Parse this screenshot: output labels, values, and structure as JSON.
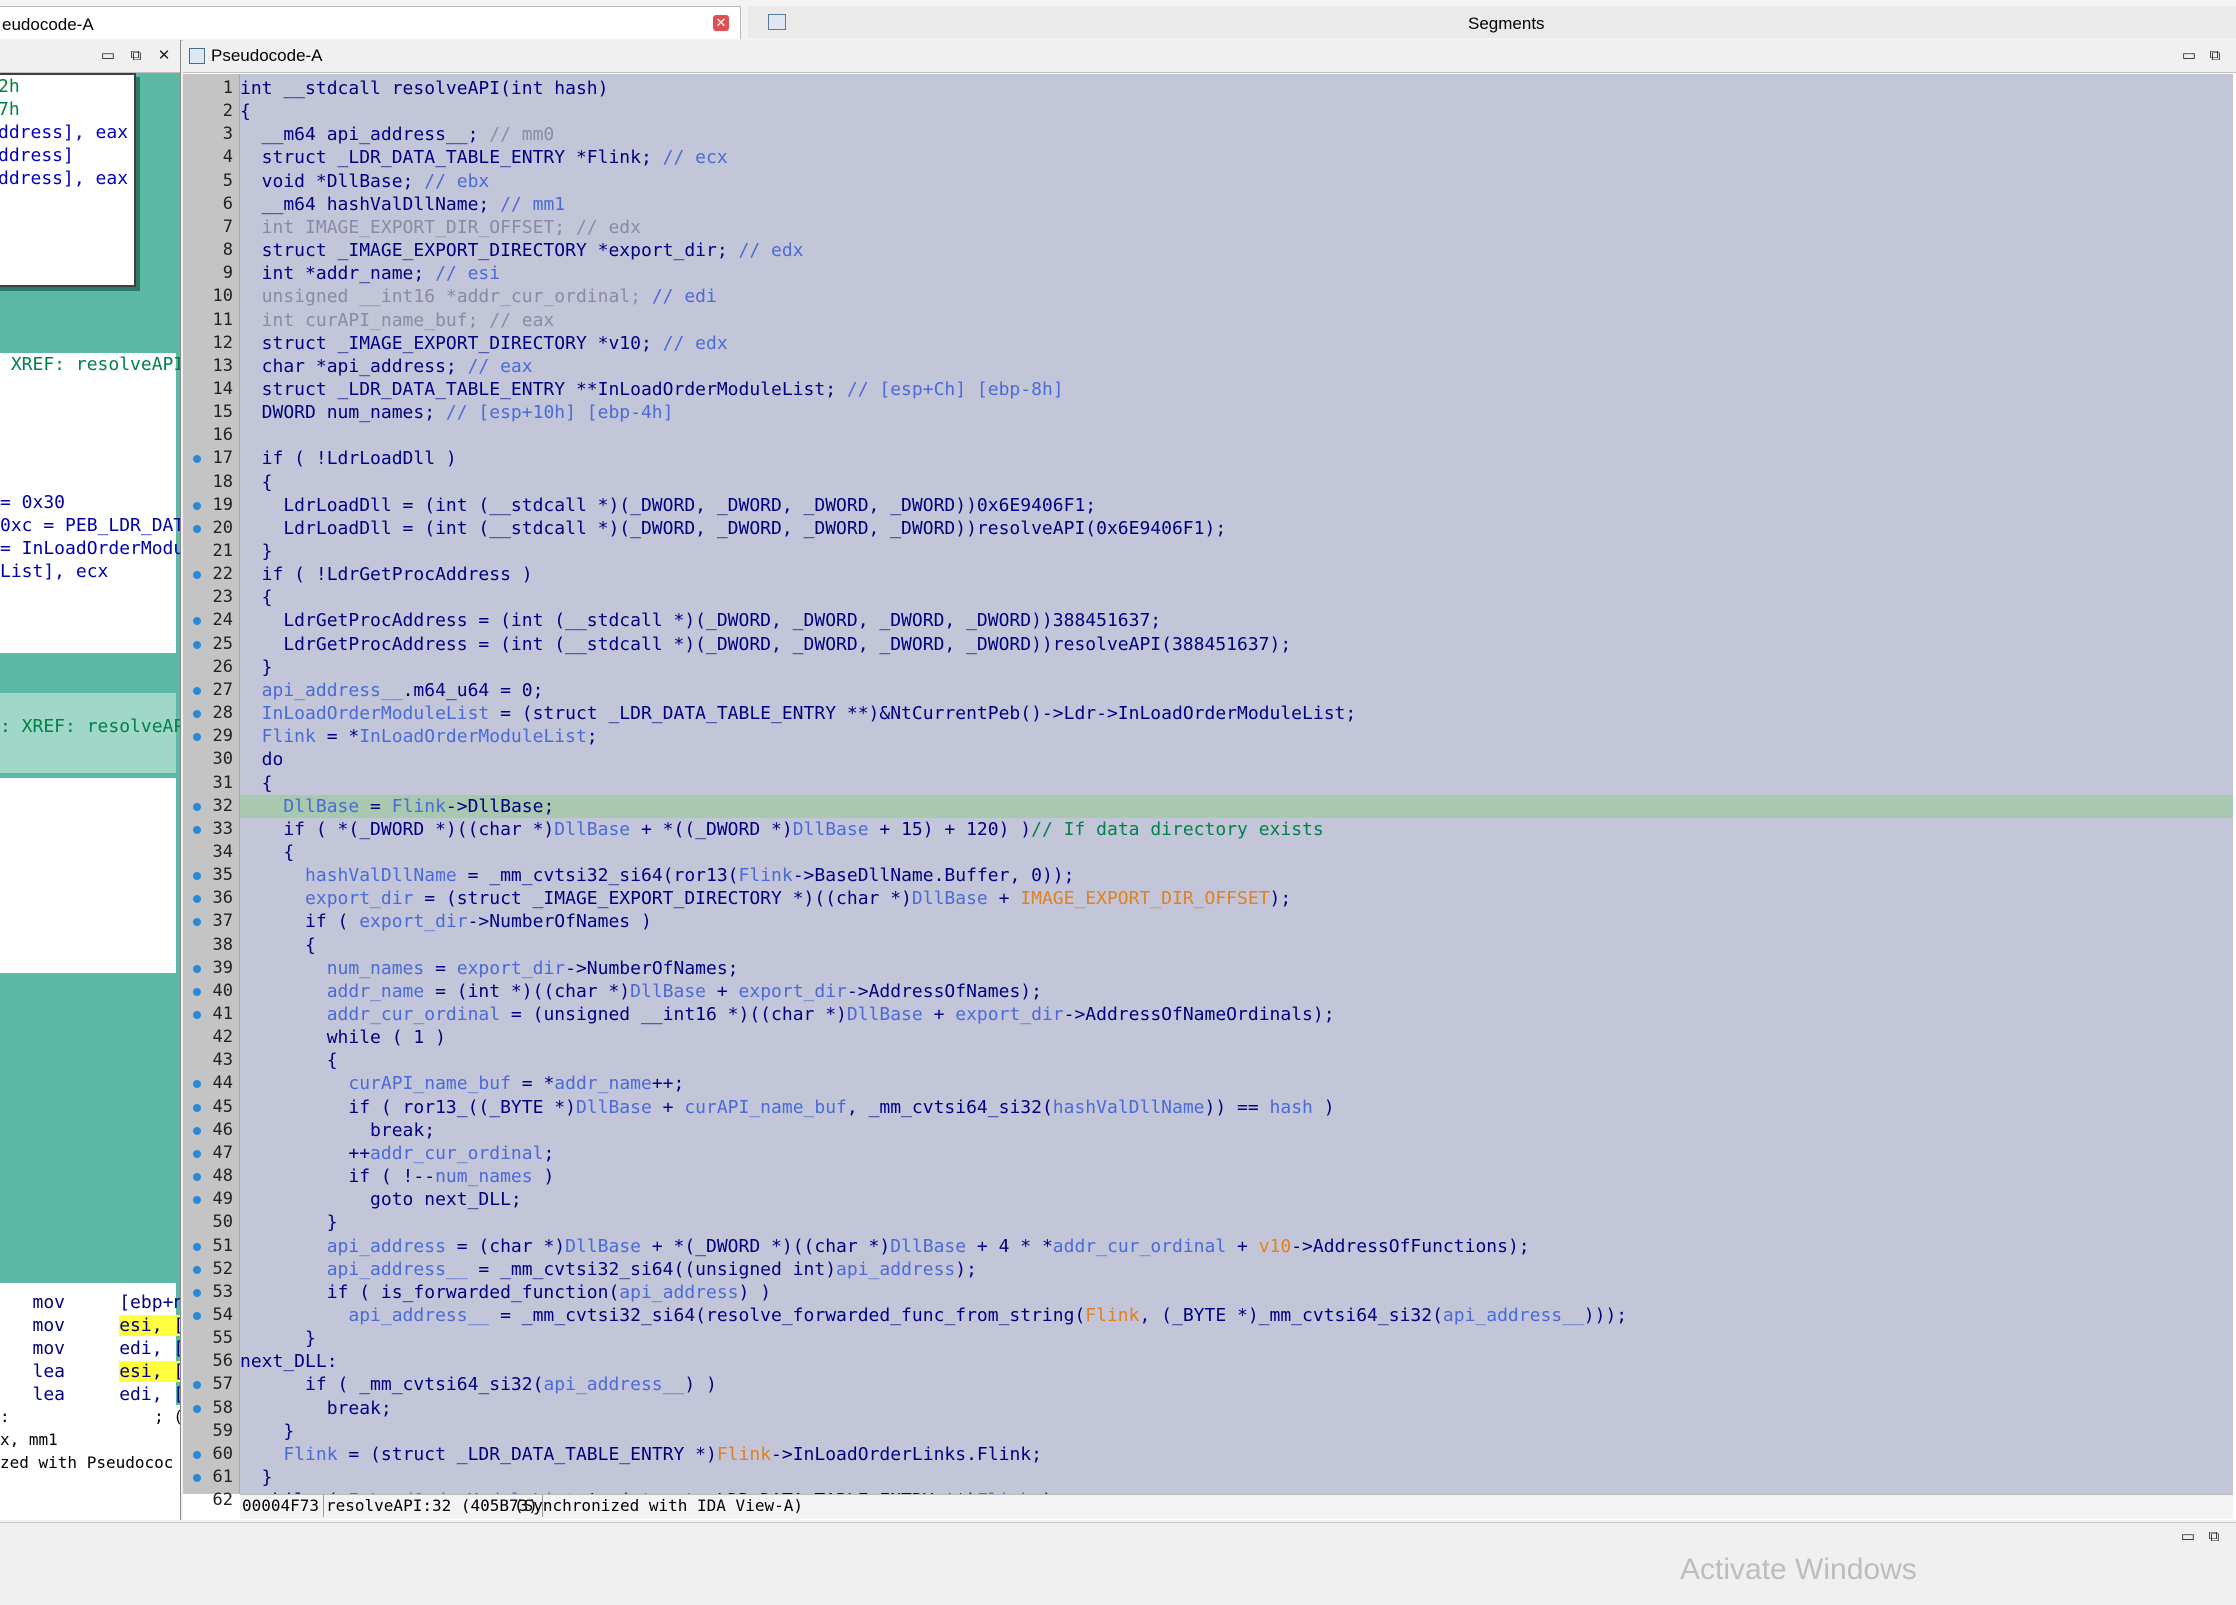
{
  "tabs": {
    "left_tab": "eudocode-A",
    "segments": "Segments"
  },
  "left_pane": {
    "graph_lines_a": [
      "2h",
      "7h",
      "ddress], eax",
      "ddress]",
      "",
      "ddress], eax"
    ],
    "xref1": " XREF: resolveAPI",
    "graph_lines_b": [
      "= 0x30",
      "0xc = PEB_LDR_DAT",
      "= InLoadOrderModu",
      "List], ecx"
    ],
    "xref2": ": XREF: resolveAP",
    "asm_lines": [
      {
        "op": "mov",
        "arg1": "[ebp+n"
      },
      {
        "op": "mov",
        "arg1": "esi, [",
        "hl": true
      },
      {
        "op": "mov",
        "arg1": "edi, ["
      },
      {
        "op": "lea",
        "arg1": "esi, [",
        "hl": true
      },
      {
        "op": "lea",
        "arg1": "edi, ["
      }
    ],
    "bottom_lines": [
      ":               ; (",
      "x, mm1",
      "zed with Pseudococ"
    ]
  },
  "main_pane": {
    "title": "Pseudocode-A",
    "code": [
      [
        [
          "k",
          "int __stdcall resolveAPI(int hash)"
        ]
      ],
      [
        [
          "k",
          "{"
        ]
      ],
      [
        [
          "k",
          "  __m64 api_address__; "
        ],
        [
          "g",
          "// mm0"
        ]
      ],
      [
        [
          "k",
          "  struct _LDR_DATA_TABLE_ENTRY *Flink; "
        ],
        [
          "v",
          "// ecx"
        ]
      ],
      [
        [
          "k",
          "  void *DllBase; "
        ],
        [
          "v",
          "// ebx"
        ]
      ],
      [
        [
          "k",
          "  __m64 hashValDllName; "
        ],
        [
          "v",
          "// mm1"
        ]
      ],
      [
        [
          "g",
          "  int IMAGE_EXPORT_DIR_OFFSET; // edx"
        ]
      ],
      [
        [
          "k",
          "  struct _IMAGE_EXPORT_DIRECTORY *export_dir; "
        ],
        [
          "v",
          "// edx"
        ]
      ],
      [
        [
          "k",
          "  int *addr_name; "
        ],
        [
          "v",
          "// esi"
        ]
      ],
      [
        [
          "g",
          "  unsigned __int16 *addr_cur_ordinal; "
        ],
        [
          "v",
          "// edi"
        ]
      ],
      [
        [
          "g",
          "  int curAPI_name_buf; // eax"
        ]
      ],
      [
        [
          "k",
          "  struct _IMAGE_EXPORT_DIRECTORY *v10; "
        ],
        [
          "v",
          "// edx"
        ]
      ],
      [
        [
          "k",
          "  char *api_address; "
        ],
        [
          "v",
          "// eax"
        ]
      ],
      [
        [
          "k",
          "  struct _LDR_DATA_TABLE_ENTRY **InLoadOrderModuleList; "
        ],
        [
          "v",
          "// [esp+Ch] [ebp-8h]"
        ]
      ],
      [
        [
          "k",
          "  DWORD num_names; "
        ],
        [
          "v",
          "// [esp+10h] [ebp-4h]"
        ]
      ],
      [
        [
          "k",
          ""
        ]
      ],
      [
        [
          "k",
          "  if ( !LdrLoadDll )"
        ]
      ],
      [
        [
          "k",
          "  {"
        ]
      ],
      [
        [
          "k",
          "    LdrLoadDll = (int (__stdcall *)(_DWORD, _DWORD, _DWORD, _DWORD))0x6E9406F1;"
        ]
      ],
      [
        [
          "k",
          "    LdrLoadDll = (int (__stdcall *)(_DWORD, _DWORD, _DWORD, _DWORD))resolveAPI(0x6E9406F1);"
        ]
      ],
      [
        [
          "k",
          "  }"
        ]
      ],
      [
        [
          "k",
          "  if ( !LdrGetProcAddress )"
        ]
      ],
      [
        [
          "k",
          "  {"
        ]
      ],
      [
        [
          "k",
          "    LdrGetProcAddress = (int (__stdcall *)(_DWORD, _DWORD, _DWORD, _DWORD))388451637;"
        ]
      ],
      [
        [
          "k",
          "    LdrGetProcAddress = (int (__stdcall *)(_DWORD, _DWORD, _DWORD, _DWORD))resolveAPI(388451637);"
        ]
      ],
      [
        [
          "k",
          "  }"
        ]
      ],
      [
        [
          "v",
          "  api_address__"
        ],
        [
          "k",
          ".m64_u64 = 0;"
        ]
      ],
      [
        [
          "v",
          "  InLoadOrderModuleList"
        ],
        [
          "k",
          " = (struct _LDR_DATA_TABLE_ENTRY **)&NtCurrentPeb()->Ldr->InLoadOrderModuleList;"
        ]
      ],
      [
        [
          "v",
          "  Flink"
        ],
        [
          "k",
          " = *"
        ],
        [
          "v",
          "InLoadOrderModuleList"
        ],
        [
          "k",
          ";"
        ]
      ],
      [
        [
          "k",
          "  do"
        ]
      ],
      [
        [
          "k",
          "  {"
        ]
      ],
      [
        [
          "v",
          "    DllBase"
        ],
        [
          "k",
          " = "
        ],
        [
          "v",
          "Flink"
        ],
        [
          "k",
          "->DllBase;"
        ]
      ],
      [
        [
          "k",
          "    if ( *(_DWORD *)((char *)"
        ],
        [
          "v",
          "DllBase"
        ],
        [
          "k",
          " + *((_DWORD *)"
        ],
        [
          "v",
          "DllBase"
        ],
        [
          "k",
          " + 15) + 120) )"
        ],
        [
          "gr",
          "// If data directory exists"
        ]
      ],
      [
        [
          "k",
          "    {"
        ]
      ],
      [
        [
          "v",
          "      hashValDllName"
        ],
        [
          "k",
          " = _mm_cvtsi32_si64(ror13("
        ],
        [
          "v",
          "Flink"
        ],
        [
          "k",
          "->BaseDllName.Buffer, 0));"
        ]
      ],
      [
        [
          "v",
          "      export_dir"
        ],
        [
          "k",
          " = (struct _IMAGE_EXPORT_DIRECTORY *)((char *)"
        ],
        [
          "v",
          "DllBase"
        ],
        [
          "k",
          " + "
        ],
        [
          "o",
          "IMAGE_EXPORT_DIR_OFFSET"
        ],
        [
          "k",
          ");"
        ]
      ],
      [
        [
          "k",
          "      if ( "
        ],
        [
          "v",
          "export_dir"
        ],
        [
          "k",
          "->NumberOfNames )"
        ]
      ],
      [
        [
          "k",
          "      {"
        ]
      ],
      [
        [
          "v",
          "        num_names"
        ],
        [
          "k",
          " = "
        ],
        [
          "v",
          "export_dir"
        ],
        [
          "k",
          "->NumberOfNames;"
        ]
      ],
      [
        [
          "v",
          "        addr_name"
        ],
        [
          "k",
          " = (int *)((char *)"
        ],
        [
          "v",
          "DllBase"
        ],
        [
          "k",
          " + "
        ],
        [
          "v",
          "export_dir"
        ],
        [
          "k",
          "->AddressOfNames);"
        ]
      ],
      [
        [
          "v",
          "        addr_cur_ordinal"
        ],
        [
          "k",
          " = (unsigned __int16 *)((char *)"
        ],
        [
          "v",
          "DllBase"
        ],
        [
          "k",
          " + "
        ],
        [
          "v",
          "export_dir"
        ],
        [
          "k",
          "->AddressOfNameOrdinals);"
        ]
      ],
      [
        [
          "k",
          "        while ( 1 )"
        ]
      ],
      [
        [
          "k",
          "        {"
        ]
      ],
      [
        [
          "v",
          "          curAPI_name_buf"
        ],
        [
          "k",
          " = *"
        ],
        [
          "v",
          "addr_name"
        ],
        [
          "k",
          "++;"
        ]
      ],
      [
        [
          "k",
          "          if ( ror13_((_BYTE *)"
        ],
        [
          "v",
          "DllBase"
        ],
        [
          "k",
          " + "
        ],
        [
          "v",
          "curAPI_name_buf"
        ],
        [
          "k",
          ", _mm_cvtsi64_si32("
        ],
        [
          "v",
          "hashValDllName"
        ],
        [
          "k",
          ")) == "
        ],
        [
          "v",
          "hash"
        ],
        [
          "k",
          " )"
        ]
      ],
      [
        [
          "k",
          "            break;"
        ]
      ],
      [
        [
          "k",
          "          ++"
        ],
        [
          "v",
          "addr_cur_ordinal"
        ],
        [
          "k",
          ";"
        ]
      ],
      [
        [
          "k",
          "          if ( !--"
        ],
        [
          "v",
          "num_names"
        ],
        [
          "k",
          " )"
        ]
      ],
      [
        [
          "k",
          "            goto next_DLL;"
        ]
      ],
      [
        [
          "k",
          "        }"
        ]
      ],
      [
        [
          "v",
          "        api_address"
        ],
        [
          "k",
          " = (char *)"
        ],
        [
          "v",
          "DllBase"
        ],
        [
          "k",
          " + *(_DWORD *)((char *)"
        ],
        [
          "v",
          "DllBase"
        ],
        [
          "k",
          " + 4 * *"
        ],
        [
          "v",
          "addr_cur_ordinal"
        ],
        [
          "k",
          " + "
        ],
        [
          "o",
          "v10"
        ],
        [
          "k",
          "->AddressOfFunctions);"
        ]
      ],
      [
        [
          "v",
          "        api_address__"
        ],
        [
          "k",
          " = _mm_cvtsi32_si64((unsigned int)"
        ],
        [
          "v",
          "api_address"
        ],
        [
          "k",
          ");"
        ]
      ],
      [
        [
          "k",
          "        if ( is_forwarded_function("
        ],
        [
          "v",
          "api_address"
        ],
        [
          "k",
          ") )"
        ]
      ],
      [
        [
          "v",
          "          api_address__"
        ],
        [
          "k",
          " = _mm_cvtsi32_si64(resolve_forwarded_func_from_string("
        ],
        [
          "o",
          "Flink"
        ],
        [
          "k",
          ", (_BYTE *)_mm_cvtsi64_si32("
        ],
        [
          "v",
          "api_address__"
        ],
        [
          "k",
          ")));"
        ]
      ],
      [
        [
          "k",
          "      }"
        ]
      ],
      [
        [
          "k",
          "next_DLL:"
        ]
      ],
      [
        [
          "k",
          "      if ( _mm_cvtsi64_si32("
        ],
        [
          "v",
          "api_address__"
        ],
        [
          "k",
          ") )"
        ]
      ],
      [
        [
          "k",
          "        break;"
        ]
      ],
      [
        [
          "k",
          "    }"
        ]
      ],
      [
        [
          "v",
          "    Flink"
        ],
        [
          "k",
          " = (struct _LDR_DATA_TABLE_ENTRY *)"
        ],
        [
          "o",
          "Flink"
        ],
        [
          "k",
          "->InLoadOrderLinks.Flink;"
        ]
      ],
      [
        [
          "k",
          "  }"
        ]
      ],
      [
        [
          "k",
          "  while ( "
        ],
        [
          "v",
          "InLoadOrderModuleList"
        ],
        [
          "k",
          " != (struct _LDR_DATA_TABLE_ENTRY **)"
        ],
        [
          "v",
          "Flink"
        ],
        [
          "k",
          " );"
        ]
      ]
    ],
    "dot_lines": [
      17,
      19,
      20,
      22,
      24,
      25,
      27,
      28,
      29,
      32,
      33,
      35,
      36,
      37,
      39,
      40,
      41,
      44,
      45,
      46,
      47,
      48,
      49,
      51,
      52,
      53,
      54,
      57,
      58,
      60,
      61
    ],
    "highlight_line": 32
  },
  "status": {
    "address": "00004F73",
    "function": "resolveAPI:32 (405B73)",
    "sync": "(Synchronized with IDA View-A)"
  },
  "watermark": "Activate Windows"
}
